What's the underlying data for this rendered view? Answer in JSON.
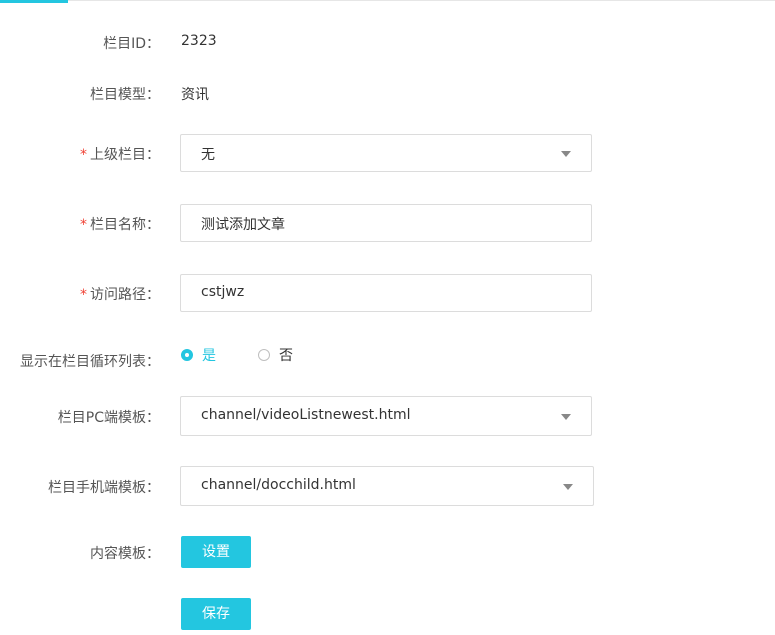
{
  "form": {
    "column_id": {
      "label": "栏目ID：",
      "value": "2323"
    },
    "column_model": {
      "label": "栏目模型：",
      "value": "资讯"
    },
    "parent_column": {
      "required_mark": "*",
      "label": "上级栏目：",
      "value": "无"
    },
    "column_name": {
      "required_mark": "*",
      "label": "栏目名称：",
      "value": "测试添加文章"
    },
    "access_path": {
      "required_mark": "*",
      "label": "访问路径：",
      "value": "cstjwz"
    },
    "show_in_loop": {
      "label": "显示在栏目循环列表：",
      "options": [
        {
          "label": "是",
          "checked": true
        },
        {
          "label": "否",
          "checked": false
        }
      ]
    },
    "pc_template": {
      "label": "栏目PC端模板：",
      "value": "channel/videoListnewest.html"
    },
    "mobile_template": {
      "label": "栏目手机端模板：",
      "value": "channel/docchild.html"
    },
    "content_template": {
      "label": "内容模板：",
      "button_label": "设置"
    },
    "save_button_label": "保存"
  },
  "colors": {
    "accent": "#23c6e0",
    "required": "#f04134"
  }
}
